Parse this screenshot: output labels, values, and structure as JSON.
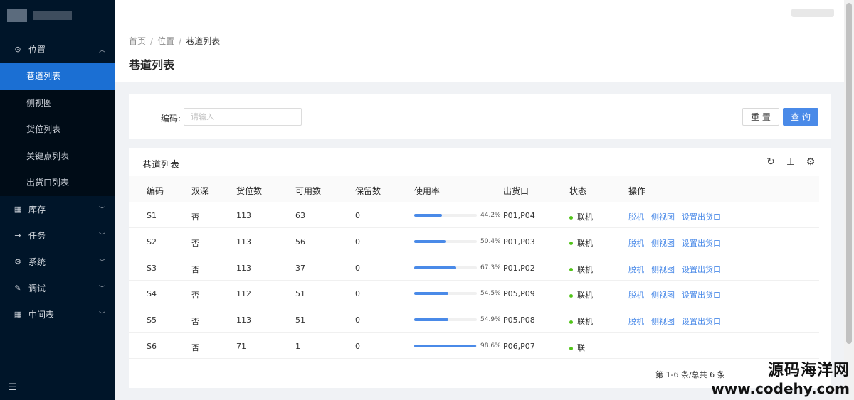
{
  "sidebar": {
    "menu": [
      {
        "label": "位置",
        "icon": "location-icon",
        "expanded": true
      },
      {
        "label": "库存",
        "icon": "grid-icon"
      },
      {
        "label": "任务",
        "icon": "arrow-right-icon"
      },
      {
        "label": "系统",
        "icon": "gear-icon"
      },
      {
        "label": "调试",
        "icon": "wrench-icon"
      },
      {
        "label": "中间表",
        "icon": "grid-icon"
      }
    ],
    "submenu": [
      "巷道列表",
      "侧视图",
      "货位列表",
      "关键点列表",
      "出货口列表"
    ],
    "active_submenu": "巷道列表"
  },
  "breadcrumb": {
    "home": "首页",
    "level1": "位置",
    "current": "巷道列表"
  },
  "page_title": "巷道列表",
  "search": {
    "label": "编码:",
    "placeholder": "请输入",
    "value": "",
    "reset_label": "重 置",
    "query_label": "查 询"
  },
  "table": {
    "title": "巷道列表",
    "columns": [
      "编码",
      "双深",
      "货位数",
      "可用数",
      "保留数",
      "使用率",
      "出货口",
      "状态",
      "操作"
    ],
    "rows": [
      {
        "code": "S1",
        "double": "否",
        "slots": "113",
        "available": "63",
        "reserved": "0",
        "usage": 44.2,
        "usage_text": "44.2%",
        "outlet": "P01,P04",
        "status": "联机"
      },
      {
        "code": "S2",
        "double": "否",
        "slots": "113",
        "available": "56",
        "reserved": "0",
        "usage": 50.4,
        "usage_text": "50.4%",
        "outlet": "P01,P03",
        "status": "联机"
      },
      {
        "code": "S3",
        "double": "否",
        "slots": "113",
        "available": "37",
        "reserved": "0",
        "usage": 67.3,
        "usage_text": "67.3%",
        "outlet": "P01,P02",
        "status": "联机"
      },
      {
        "code": "S4",
        "double": "否",
        "slots": "112",
        "available": "51",
        "reserved": "0",
        "usage": 54.5,
        "usage_text": "54.5%",
        "outlet": "P05,P09",
        "status": "联机"
      },
      {
        "code": "S5",
        "double": "否",
        "slots": "113",
        "available": "51",
        "reserved": "0",
        "usage": 54.9,
        "usage_text": "54.9%",
        "outlet": "P05,P08",
        "status": "联机"
      },
      {
        "code": "S6",
        "double": "否",
        "slots": "71",
        "available": "1",
        "reserved": "0",
        "usage": 98.6,
        "usage_text": "98.6%",
        "outlet": "P06,P07",
        "status": "联"
      }
    ],
    "actions": [
      "脱机",
      "侧视图",
      "设置出货口"
    ],
    "pagination_text": "第 1-6 条/总共 6 条"
  },
  "watermark": {
    "line1": "源码海洋网",
    "line2": "www.codehy.com"
  },
  "colors": {
    "sidebar_bg": "#001529",
    "accent": "#4a8ae8",
    "online": "#52c41a"
  }
}
